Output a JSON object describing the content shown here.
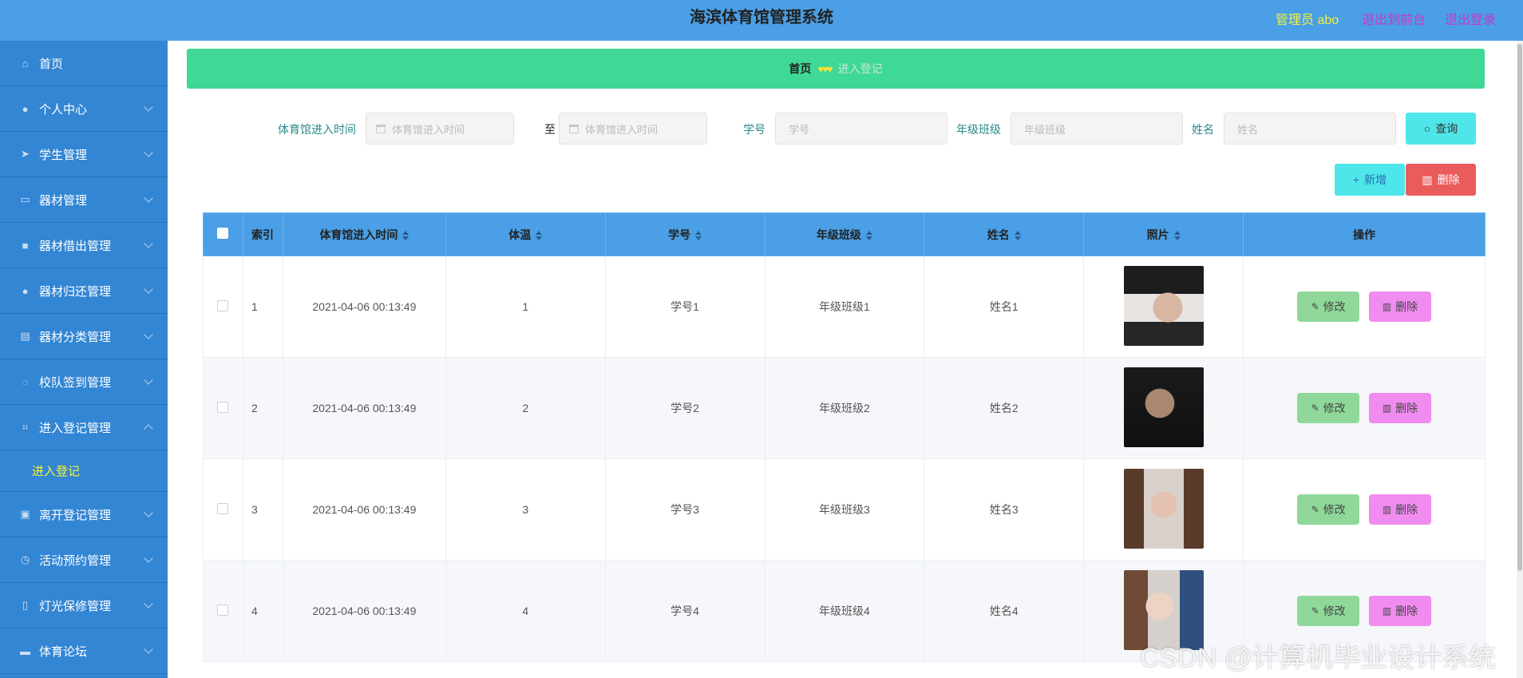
{
  "header": {
    "title": "海滨体育馆管理系统",
    "admin": "管理员 abo",
    "back_to_front": "退出到前台",
    "logout": "退出登录"
  },
  "sidebar": {
    "items": [
      {
        "label": "首页",
        "icon": "home-icon"
      },
      {
        "label": "个人中心",
        "icon": "user-icon"
      },
      {
        "label": "学生管理",
        "icon": "send-icon"
      },
      {
        "label": "器材管理",
        "icon": "chat-icon"
      },
      {
        "label": "器材借出管理",
        "icon": "message-icon"
      },
      {
        "label": "器材归还管理",
        "icon": "user-icon"
      },
      {
        "label": "器材分类管理",
        "icon": "clipboard-icon"
      },
      {
        "label": "校队签到管理",
        "icon": "power-icon"
      },
      {
        "label": "进入登记管理",
        "icon": "crop-icon"
      },
      {
        "label": "离开登记管理",
        "icon": "suitcase-icon"
      },
      {
        "label": "活动预约管理",
        "icon": "clock-icon"
      },
      {
        "label": "灯光保修管理",
        "icon": "phone-icon"
      },
      {
        "label": "体育论坛",
        "icon": "monitor-icon"
      }
    ],
    "sub_active": "进入登记"
  },
  "breadcrumb": {
    "home": "首页",
    "hearts": "♥♥♥",
    "current": "进入登记"
  },
  "search": {
    "time_label": "体育馆进入时间",
    "time_from_placeholder": "体育馆进入时间",
    "to": "至",
    "time_to_placeholder": "体育馆进入时间",
    "sid_label": "学号",
    "sid_placeholder": "学号",
    "class_label": "年级班级",
    "class_placeholder": "年级班级",
    "name_label": "姓名",
    "name_placeholder": "姓名",
    "query": "查询"
  },
  "actions": {
    "add": "新增",
    "delete": "删除"
  },
  "table": {
    "headers": {
      "index": "索引",
      "time": "体育馆进入时间",
      "temp": "体温",
      "sid": "学号",
      "class": "年级班级",
      "name": "姓名",
      "photo": "照片",
      "ops": "操作"
    },
    "rows": [
      {
        "index": "1",
        "time": "2021-04-06 00:13:49",
        "temp": "1",
        "sid": "学号1",
        "class": "年级班级1",
        "name": "姓名1"
      },
      {
        "index": "2",
        "time": "2021-04-06 00:13:49",
        "temp": "2",
        "sid": "学号2",
        "class": "年级班级2",
        "name": "姓名2"
      },
      {
        "index": "3",
        "time": "2021-04-06 00:13:49",
        "temp": "3",
        "sid": "学号3",
        "class": "年级班级3",
        "name": "姓名3"
      },
      {
        "index": "4",
        "time": "2021-04-06 00:13:49",
        "temp": "4",
        "sid": "学号4",
        "class": "年级班级4",
        "name": "姓名4"
      }
    ],
    "edit": "修改",
    "delete": "删除"
  },
  "watermark": "CSDN @计算机毕业设计系统",
  "colors": {
    "header": "#4a9fe6",
    "sidebar": "#3386d4",
    "breadcrumb": "#3fd895",
    "accent_yellow": "#f7f13b",
    "query": "#4fe6ea",
    "danger": "#ea5c5c",
    "edit": "#8fd89a",
    "row_delete": "#f08cf0"
  }
}
